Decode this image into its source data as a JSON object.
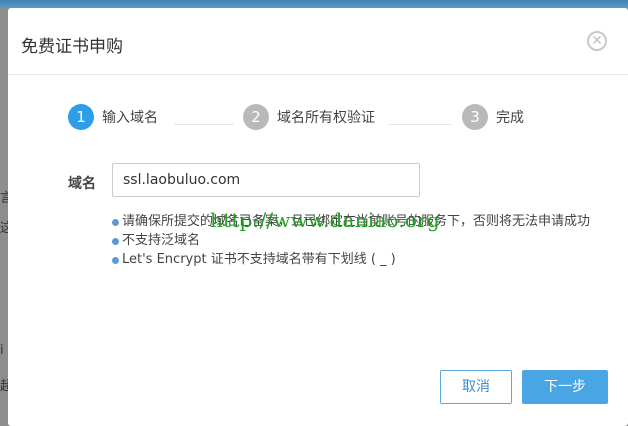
{
  "dialog": {
    "title": "免费证书申购"
  },
  "steps": [
    {
      "number": "1",
      "label": "输入域名",
      "state": "active"
    },
    {
      "number": "2",
      "label": "域名所有权验证",
      "state": "inactive"
    },
    {
      "number": "3",
      "label": "完成",
      "state": "inactive"
    }
  ],
  "form": {
    "domain_label": "域名",
    "domain_value": "ssl.laobuluo.com"
  },
  "notes": [
    "请确保所提交的域名已备案，且已绑定在当前账号的服务下，否则将无法申请成功",
    "不支持泛域名",
    "Let's Encrypt 证书不支持域名带有下划线 ( _ )"
  ],
  "watermark": "http://www.daniao.org",
  "buttons": {
    "cancel": "取消",
    "next": "下一步"
  },
  "colors": {
    "accent": "#2e9ee6",
    "inactive_step": "#b9b9b9",
    "watermark": "#22a022"
  }
}
